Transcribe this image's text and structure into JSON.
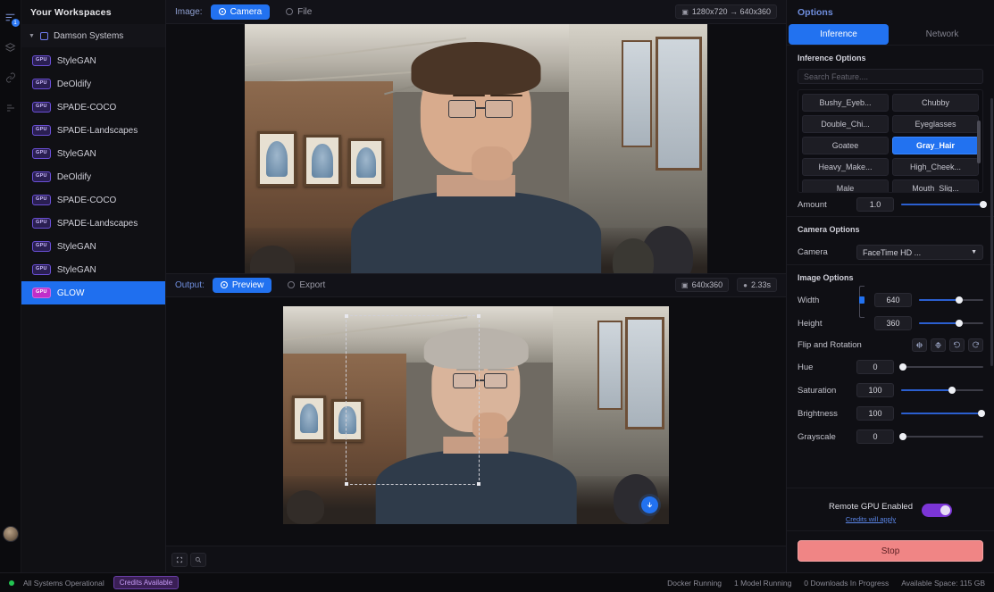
{
  "rail": {
    "icons": [
      {
        "name": "notifications-icon",
        "glyph": "☰",
        "badge": "1",
        "active": true
      },
      {
        "name": "models-icon",
        "glyph": "⬢",
        "badge": "",
        "active": false
      },
      {
        "name": "link-icon",
        "glyph": "🔗",
        "badge": "",
        "active": false
      },
      {
        "name": "queue-icon",
        "glyph": "≣",
        "badge": "",
        "active": false
      }
    ]
  },
  "sidebar": {
    "title": "Your Workspaces",
    "group": {
      "label": "Damson Systems",
      "expanded": true
    },
    "items": [
      {
        "badge": "GPU",
        "label": "StyleGAN",
        "selected": false
      },
      {
        "badge": "GPU",
        "label": "DeOldify",
        "selected": false
      },
      {
        "badge": "GPU",
        "label": "SPADE-COCO",
        "selected": false
      },
      {
        "badge": "GPU",
        "label": "SPADE-Landscapes",
        "selected": false
      },
      {
        "badge": "GPU",
        "label": "StyleGAN",
        "selected": false
      },
      {
        "badge": "GPU",
        "label": "DeOldify",
        "selected": false
      },
      {
        "badge": "GPU",
        "label": "SPADE-COCO",
        "selected": false
      },
      {
        "badge": "GPU",
        "label": "SPADE-Landscapes",
        "selected": false
      },
      {
        "badge": "GPU",
        "label": "StyleGAN",
        "selected": false
      },
      {
        "badge": "GPU",
        "label": "StyleGAN",
        "selected": false
      },
      {
        "badge": "GPU",
        "label": "GLOW",
        "selected": true
      }
    ]
  },
  "input_bar": {
    "label": "Image:",
    "options": [
      {
        "label": "Camera",
        "selected": true
      },
      {
        "label": "File",
        "selected": false
      }
    ],
    "resolution_badge": "1280x720 → 640x360"
  },
  "output_bar": {
    "label": "Output:",
    "options": [
      {
        "label": "Preview",
        "selected": true
      },
      {
        "label": "Export",
        "selected": false
      }
    ],
    "resolution_badge": "640x360",
    "time_badge": "2.33s"
  },
  "bottom_tools": [
    {
      "name": "fit-view-button",
      "glyph": "⬚"
    },
    {
      "name": "zoom-view-button",
      "glyph": "⧉"
    }
  ],
  "fab": {
    "name": "download-button",
    "glyph": "⬇"
  },
  "options": {
    "title": "Options",
    "tabs": [
      {
        "label": "Inference",
        "selected": true
      },
      {
        "label": "Network",
        "selected": false
      }
    ],
    "inference": {
      "section_title": "Inference Options",
      "search_placeholder": "Search Feature....",
      "features": [
        {
          "label": "Bushy_Eyeb...",
          "selected": false
        },
        {
          "label": "Chubby",
          "selected": false
        },
        {
          "label": "Double_Chi...",
          "selected": false
        },
        {
          "label": "Eyeglasses",
          "selected": false
        },
        {
          "label": "Goatee",
          "selected": false
        },
        {
          "label": "Gray_Hair",
          "selected": true
        },
        {
          "label": "Heavy_Make...",
          "selected": false
        },
        {
          "label": "High_Cheek...",
          "selected": false
        },
        {
          "label": "Male",
          "selected": false
        },
        {
          "label": "Mouth_Slig...",
          "selected": false
        }
      ],
      "amount": {
        "label": "Amount",
        "value": "1.0",
        "percent": 100
      }
    },
    "camera": {
      "section_title": "Camera Options",
      "label": "Camera",
      "value": "FaceTime HD ..."
    },
    "image": {
      "section_title": "Image Options",
      "width": {
        "label": "Width",
        "value": "640",
        "percent": 62
      },
      "height": {
        "label": "Height",
        "value": "360",
        "percent": 62
      },
      "flip": {
        "label": "Flip and Rotation",
        "buttons": [
          "flip-horizontal-icon",
          "flip-vertical-icon",
          "rotate-left-icon",
          "rotate-right-icon"
        ]
      },
      "hue": {
        "label": "Hue",
        "value": "0",
        "percent": 2
      },
      "saturation": {
        "label": "Saturation",
        "value": "100",
        "percent": 62
      },
      "brightness": {
        "label": "Brightness",
        "value": "100",
        "percent": 98
      },
      "grayscale": {
        "label": "Grayscale",
        "value": "0",
        "percent": 2
      }
    },
    "gpu": {
      "title": "Remote GPU Enabled",
      "subtitle": "Credits will apply",
      "enabled": true
    },
    "action": {
      "label": "Stop"
    }
  },
  "status": {
    "health": "All Systems Operational",
    "credits": "Credits Available",
    "right": [
      "Docker Running",
      "1 Model Running",
      "0 Downloads In Progress",
      "Available Space: 115 GB"
    ]
  },
  "colors": {
    "accent": "#2272f0",
    "selected": "#1f6fef",
    "gpu_badge": "#c02ec9",
    "stop": "#f08585",
    "toggle": "#7b35d6",
    "ok": "#23c552"
  }
}
